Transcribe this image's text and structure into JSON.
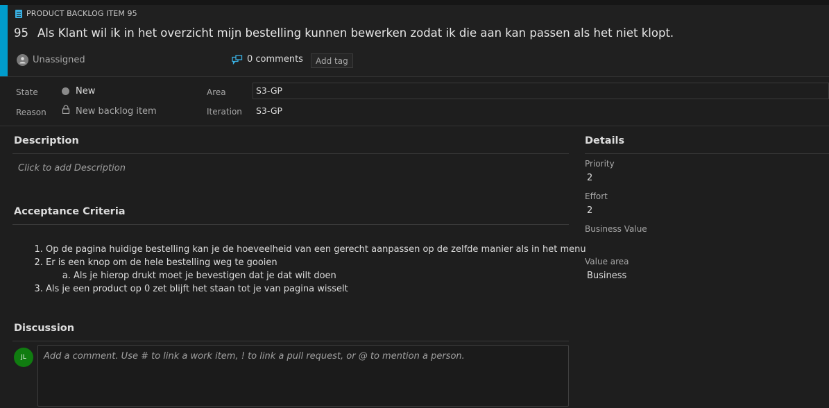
{
  "work_item": {
    "type_label": "PRODUCT BACKLOG ITEM 95",
    "id": "95",
    "title": "Als Klant wil ik in het overzicht mijn bestelling kunnen bewerken zodat ik die aan kan passen als het niet klopt.",
    "assignee": "Unassigned",
    "comments_label": "0 comments",
    "add_tag_label": "Add tag",
    "accent_color": "#009ccc"
  },
  "fields": {
    "state_label": "State",
    "state_value": "New",
    "reason_label": "Reason",
    "reason_value": "New backlog item",
    "area_label": "Area",
    "area_value": "S3-GP",
    "iteration_label": "Iteration",
    "iteration_value": "S3-GP"
  },
  "description": {
    "title": "Description",
    "placeholder": "Click to add Description"
  },
  "acceptance": {
    "title": "Acceptance Criteria",
    "items": [
      "Op de pagina huidige bestelling kan je de hoeveelheid van een gerecht aanpassen op de zelfde manier als in het menu",
      "Er is een knop om de hele bestelling weg te gooien",
      "Als je een product op 0 zet blijft het staan tot je van pagina wisselt"
    ],
    "subitem": "Als je hierop drukt moet je bevestigen dat je dat wilt doen"
  },
  "discussion": {
    "title": "Discussion",
    "avatar_initials": "JL",
    "placeholder": "Add a comment. Use # to link a work item, ! to link a pull request, or @ to mention a person."
  },
  "details": {
    "title": "Details",
    "priority_label": "Priority",
    "priority_value": "2",
    "effort_label": "Effort",
    "effort_value": "2",
    "business_value_label": "Business Value",
    "business_value_value": "",
    "value_area_label": "Value area",
    "value_area_value": "Business"
  }
}
